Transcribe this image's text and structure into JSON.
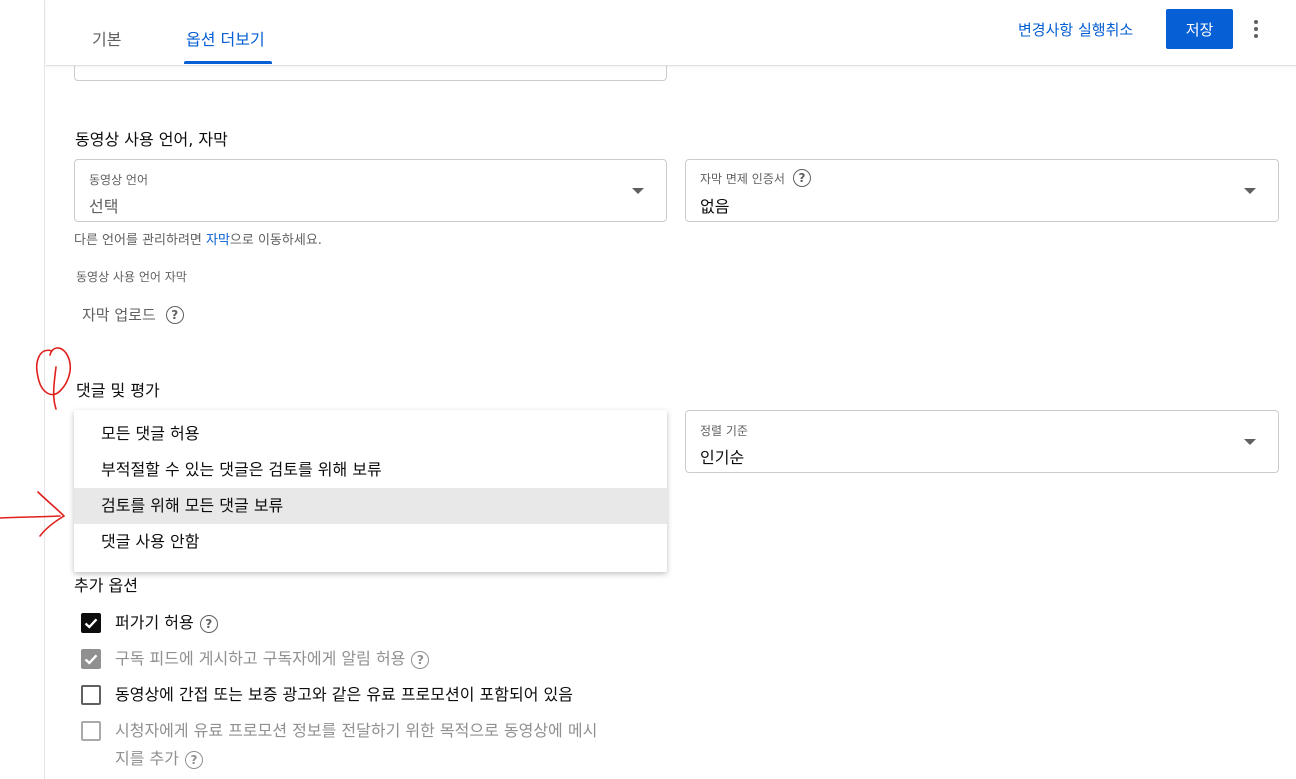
{
  "header": {
    "tabs": [
      {
        "label": "기본"
      },
      {
        "label": "옵션 더보기"
      }
    ],
    "revert_label": "변경사항 실행취소",
    "save_label": "저장"
  },
  "language_section": {
    "title": "동영상 사용 언어, 자막",
    "video_language": {
      "label": "동영상 언어",
      "value": "선택"
    },
    "caption_certification": {
      "label": "자막 면제 인증서",
      "value": "없음"
    },
    "hint_prefix": "다른 언어를 관리하려면 ",
    "hint_link": "자막",
    "hint_suffix": "으로 이동하세요.",
    "captions_subtitle": "동영상 사용 언어 자막",
    "upload_label": "자막 업로드"
  },
  "comments_section": {
    "title": "댓글 및 평가",
    "options": [
      "모든 댓글 허용",
      "부적절할 수 있는 댓글은 검토를 위해 보류",
      "검토를 위해 모든 댓글 보류",
      "댓글 사용 안함"
    ],
    "sort": {
      "label": "정렬 기준",
      "value": "인기순"
    }
  },
  "extra_section": {
    "title": "추가 옵션",
    "options": [
      {
        "label": "퍼가기 허용",
        "checked": true,
        "disabled": false,
        "help": true
      },
      {
        "label": "구독 피드에 게시하고 구독자에게 알림 허용",
        "checked": true,
        "disabled": true,
        "help": true
      },
      {
        "label": "동영상에 간접 또는 보증 광고와 같은 유료 프로모션이 포함되어 있음",
        "checked": false,
        "disabled": false,
        "help": false
      },
      {
        "label_line1": "시청자에게 유료 프로모션 정보를 전달하기 위한 목적으로 동영상에 메시",
        "label_line2": "지를 추가",
        "checked": false,
        "disabled": true,
        "help": true
      }
    ]
  },
  "colors": {
    "accent": "#065fd4",
    "annotation": "#e0201c"
  }
}
